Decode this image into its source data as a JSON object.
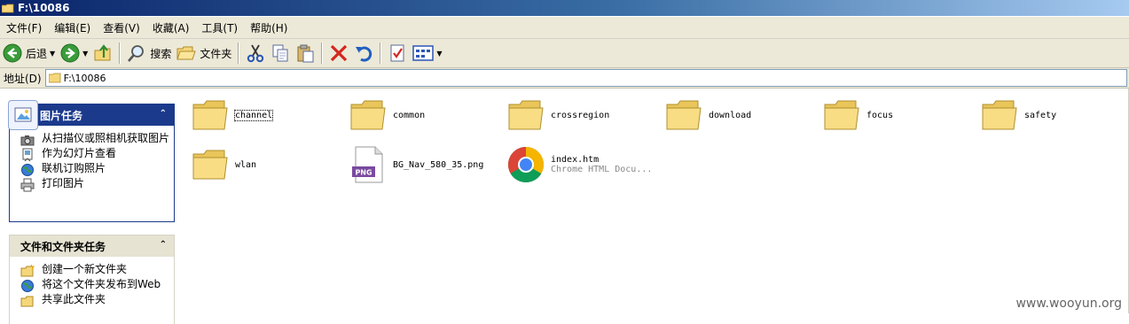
{
  "window": {
    "title": "F:\\10086"
  },
  "menu": [
    "文件(F)",
    "编辑(E)",
    "查看(V)",
    "收藏(A)",
    "工具(T)",
    "帮助(H)"
  ],
  "toolbar": {
    "back_label": "后退",
    "search_label": "搜索",
    "folders_label": "文件夹"
  },
  "address": {
    "label": "地址(D)",
    "value": "F:\\10086"
  },
  "picture_tasks": {
    "title": "图片任务",
    "items": [
      "从扫描仪或照相机获取图片",
      "作为幻灯片查看",
      "联机订购照片",
      "打印图片"
    ]
  },
  "file_tasks": {
    "title": "文件和文件夹任务",
    "items": [
      "创建一个新文件夹",
      "将这个文件夹发布到Web",
      "共享此文件夹"
    ]
  },
  "files": [
    {
      "name": "channel",
      "kind": "folder"
    },
    {
      "name": "common",
      "kind": "folder"
    },
    {
      "name": "crossregion",
      "kind": "folder"
    },
    {
      "name": "download",
      "kind": "folder"
    },
    {
      "name": "focus",
      "kind": "folder"
    },
    {
      "name": "safety",
      "kind": "folder"
    },
    {
      "name": "wlan",
      "kind": "folder"
    },
    {
      "name": "BG_Nav_580_35.png",
      "kind": "png",
      "badge": "PNG"
    },
    {
      "name": "index.htm",
      "kind": "chrome",
      "type": "Chrome HTML Docu..."
    }
  ],
  "watermark": "www.wooyun.org",
  "colors": {
    "title_start": "#0a246a",
    "task_header": "#1c3a8c",
    "folder": "#f5d77a"
  }
}
